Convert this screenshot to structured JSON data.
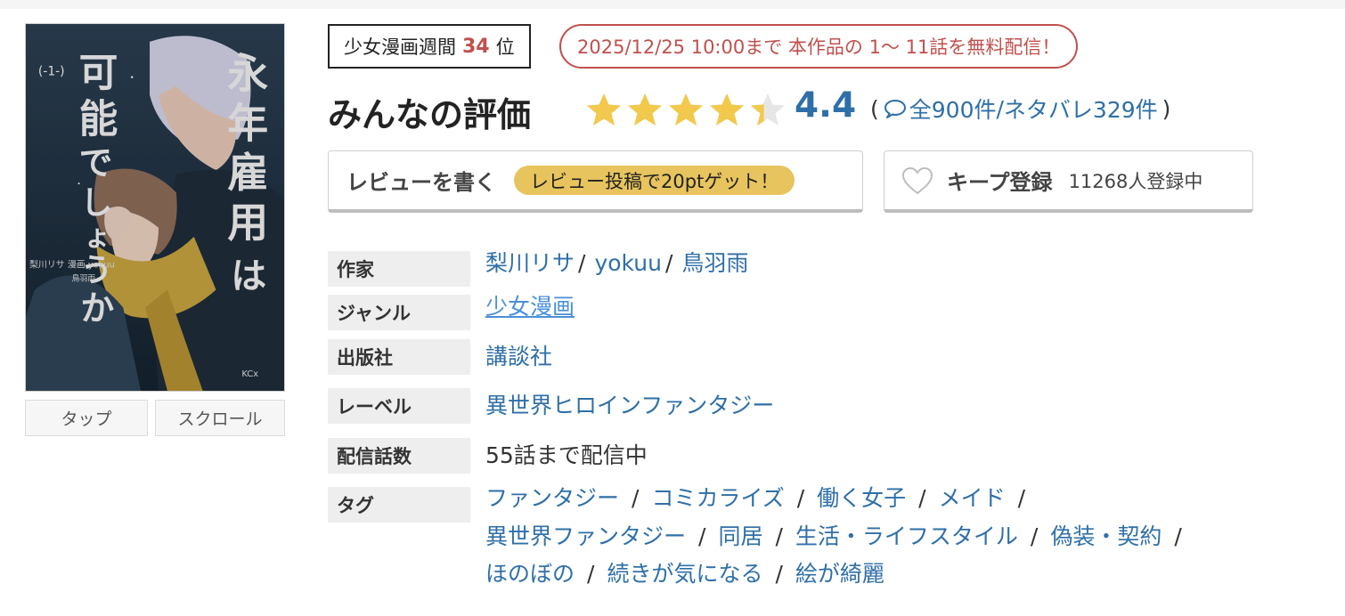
{
  "cover": {
    "title_chars": [
      "永",
      "年",
      "雇",
      "用",
      "は"
    ],
    "title_chars2": [
      "可",
      "能",
      "で",
      "し",
      "ょ",
      "う",
      "か"
    ],
    "volume": "(-1-)",
    "authors_small": "梨川リサ　漫画 yokuu",
    "label_small": "KCx",
    "buttons": {
      "tap": "タップ",
      "scroll": "スクロール"
    }
  },
  "rank": {
    "prefix": "少女漫画週間",
    "number": "34",
    "suffix": "位"
  },
  "free_notice": "2025/12/25 10:00まで 本作品の 1〜 11話を無料配信！",
  "rating": {
    "title": "みんなの評価",
    "score": "4.4",
    "score_value": 4.4,
    "max": 5,
    "count_all": "全900件",
    "count_spoiler": "ネタバレ329件",
    "open_paren": "(",
    "close_paren": ")",
    "slash": "/"
  },
  "review_button": {
    "label": "レビューを書く",
    "pill": "レビュー投稿で20ptゲット！"
  },
  "keep_button": {
    "label": "キープ登録",
    "count": "11268人登録中"
  },
  "info": {
    "author": {
      "label": "作家",
      "values": [
        "梨川リサ",
        "yokuu",
        "鳥羽雨"
      ]
    },
    "genre": {
      "label": "ジャンル",
      "value": "少女漫画"
    },
    "publisher": {
      "label": "出版社",
      "value": "講談社"
    },
    "imprint": {
      "label": "レーベル",
      "value": "異世界ヒロインファンタジー"
    },
    "episodes": {
      "label": "配信話数",
      "value": "55話まで配信中"
    },
    "tags": {
      "label": "タグ",
      "items": [
        "ファンタジー",
        "コミカライズ",
        "働く女子",
        "メイド",
        "異世界ファンタジー",
        "同居",
        "生活・ライフスタイル",
        "偽装・契約",
        "ほのぼの",
        "続きが気になる",
        "絵が綺麗"
      ]
    }
  },
  "colors": {
    "accent_red": "#c0504d",
    "link_blue": "#2f6fa8",
    "star_gold": "#f2c94c",
    "pill_gold": "#e8c45e"
  },
  "icons": {
    "star": "star-icon",
    "bubble": "speech-bubble-icon",
    "heart": "heart-icon"
  }
}
